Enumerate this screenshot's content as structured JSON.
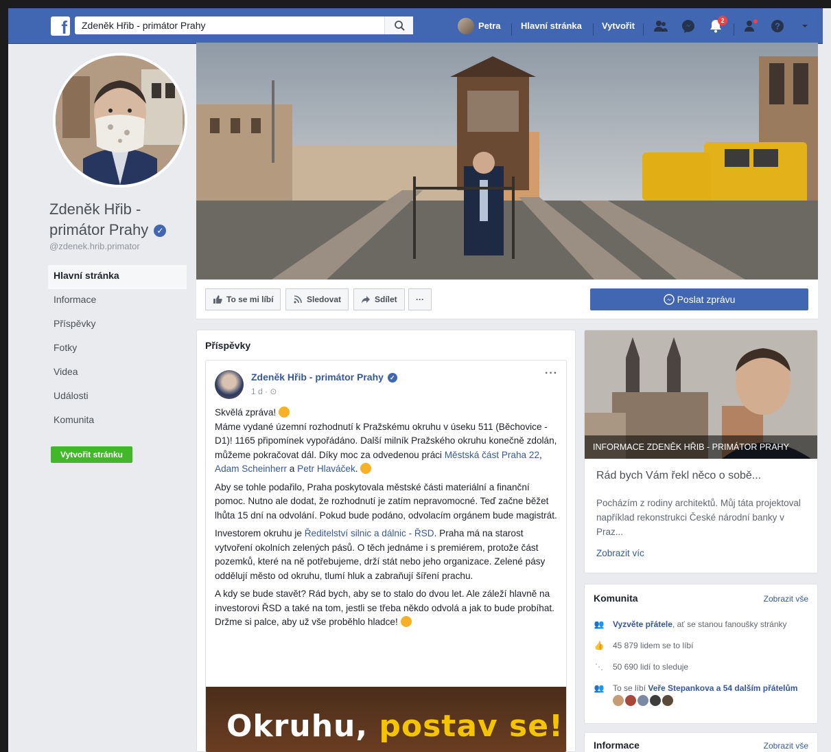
{
  "topbar": {
    "search_value": "Zdeněk Hřib - primátor Prahy",
    "user_name": "Petra",
    "home_label": "Hlavní stránka",
    "create_label": "Vytvořit",
    "notifications_count": "2"
  },
  "page": {
    "name": "Zdeněk Hřib - primátor Prahy",
    "handle": "@zdenek.hrib.primator",
    "create_page_label": "Vytvořit stránku"
  },
  "sidebar": {
    "items": [
      {
        "label": "Hlavní stránka"
      },
      {
        "label": "Informace"
      },
      {
        "label": "Příspěvky"
      },
      {
        "label": "Fotky"
      },
      {
        "label": "Videa"
      },
      {
        "label": "Události"
      },
      {
        "label": "Komunita"
      }
    ]
  },
  "actions": {
    "like_label": "To se mi líbí",
    "follow_label": "Sledovat",
    "share_label": "Sdílet",
    "more_label": "···",
    "send_message_label": "Poslat zprávu"
  },
  "posts_section": {
    "title": "Příspěvky",
    "post": {
      "author": "Zdeněk Hřib - primátor Prahy",
      "time": "1 d",
      "p1_a": "Skvělá zpráva! ",
      "p1_b": "Máme vydané územní rozhodnutí k Pražskému okruhu v úseku 511 (Běchovice - D1)! 1165 připomínek vypořádáno. Další milník Pražského okruhu konečně zdolán, můžeme pokračovat dál. Díky moc za odvedenou práci ",
      "p1_link1": "Městská část Praha 22",
      "p1_sep1": ", ",
      "p1_link2": "Adam Scheinherr",
      "p1_sep2": " a ",
      "p1_link3": "Petr Hlaváček",
      "p1_end": ". ",
      "p2": "Aby se tohle podařilo, Praha poskytovala městské části materiální a finanční pomoc. Nutno ale dodat, že rozhodnutí je zatím nepravomocné. Teď začne běžet lhůta 15 dní na odvolání. Pokud bude podáno, odvolacím orgánem bude magistrát.",
      "p3_a": "Investorem okruhu je ",
      "p3_link": "Ředitelství silnic a dálnic - ŘSD",
      "p3_b": ". Praha má na starost vytvoření okolních zelených pásů. O těch jednáme i s premiérem, protože část pozemků, které na ně potřebujeme, drží stát nebo jeho organizace. Zelené pásy oddělují město od okruhu, tlumí hluk a zabraňují šíření prachu.",
      "p4": "A kdy se bude stavět? Rád bych, aby se to stalo do dvou let. Ale záleží hlavně na investorovi ŘSD a také na tom, jestli se třeba někdo odvolá a jak to bude probíhat. Držme si palce, aby už vše proběhlo hladce! ",
      "image_text_a": "Okruhu, ",
      "image_text_b": "postav se!"
    }
  },
  "about": {
    "photo_title": "INFORMACE ZDENĚK HŘIB - PRIMÁTOR PRAHY",
    "headline": "Rád bych Vám řekl něco o sobě...",
    "text": "Pocházím z rodiny architektů. Můj táta projektoval například rekonstrukci České národní banky v Praz...",
    "more_label": "Zobrazit víc"
  },
  "community": {
    "title": "Komunita",
    "see_all": "Zobrazit vše",
    "invite_link": "Vyzvěte přátele",
    "invite_rest": ", ať se stanou fanoušky stránky",
    "likes": "45 879 lidem se to líbí",
    "follows": "50 690 lidí to sleduje",
    "friends_prefix": "To se líbí ",
    "friends_link": "Veře Stepankova a 54 dalším přátelům"
  },
  "info_card": {
    "title": "Informace",
    "see_all": "Zobrazit vše"
  },
  "colors": {
    "brand": "#4267b2",
    "link": "#365899",
    "create_green": "#42b72a"
  }
}
